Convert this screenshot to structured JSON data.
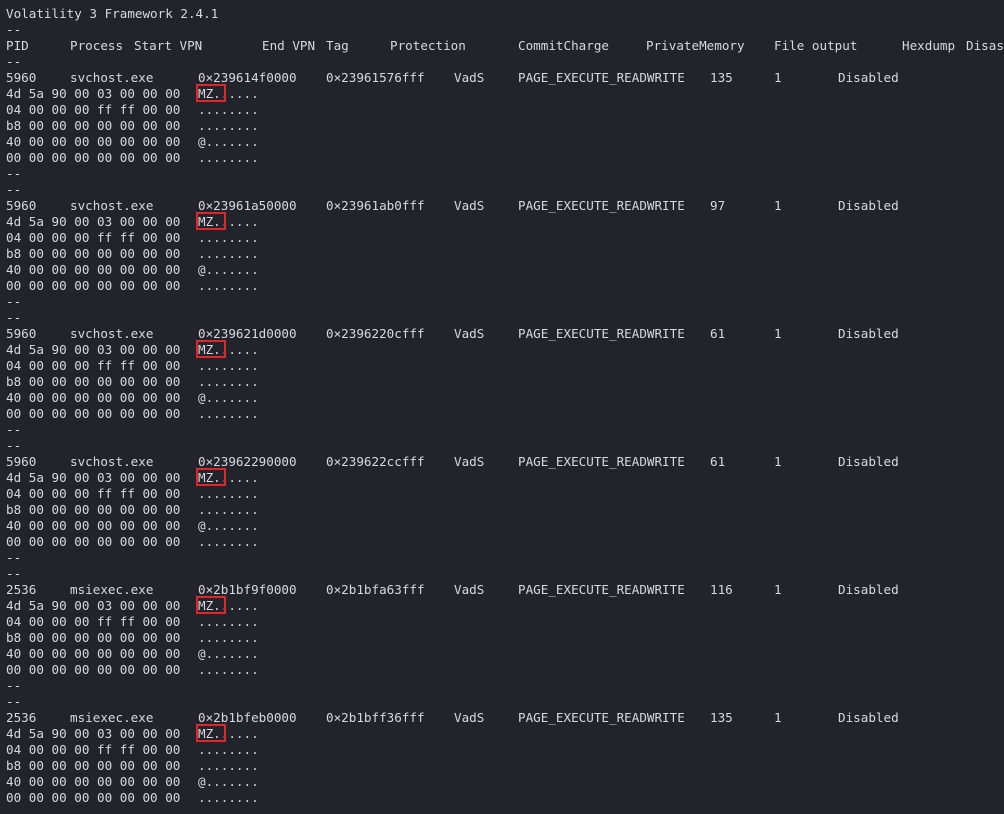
{
  "title": "Volatility 3 Framework 2.4.1",
  "separator": "--",
  "headers": [
    "PID",
    "Process",
    "Start VPN",
    "End VPN",
    "Tag",
    "Protection",
    "CommitCharge",
    "PrivateMemory",
    "File output",
    "Hexdump",
    "Disas"
  ],
  "entries": [
    {
      "pid": "5960",
      "process": "svchost.exe",
      "start_vpn": "0×239614f0000",
      "end_vpn": "0×23961576fff",
      "tag": "VadS",
      "protection": "PAGE_EXECUTE_READWRITE",
      "commit_charge": "135",
      "private_memory": "1",
      "file_output": "Disabled",
      "hexdump": [
        {
          "hex": "4d 5a 90 00 03 00 00 00",
          "ascii": "MZ......"
        },
        {
          "hex": "04 00 00 00 ff ff 00 00",
          "ascii": "........"
        },
        {
          "hex": "b8 00 00 00 00 00 00 00",
          "ascii": "........"
        },
        {
          "hex": "40 00 00 00 00 00 00 00",
          "ascii": "@......."
        },
        {
          "hex": "00 00 00 00 00 00 00 00",
          "ascii": "........"
        }
      ]
    },
    {
      "pid": "5960",
      "process": "svchost.exe",
      "start_vpn": "0×23961a50000",
      "end_vpn": "0×23961ab0fff",
      "tag": "VadS",
      "protection": "PAGE_EXECUTE_READWRITE",
      "commit_charge": "97",
      "private_memory": "1",
      "file_output": "Disabled",
      "hexdump": [
        {
          "hex": "4d 5a 90 00 03 00 00 00",
          "ascii": "MZ......"
        },
        {
          "hex": "04 00 00 00 ff ff 00 00",
          "ascii": "........"
        },
        {
          "hex": "b8 00 00 00 00 00 00 00",
          "ascii": "........"
        },
        {
          "hex": "40 00 00 00 00 00 00 00",
          "ascii": "@......."
        },
        {
          "hex": "00 00 00 00 00 00 00 00",
          "ascii": "........"
        }
      ]
    },
    {
      "pid": "5960",
      "process": "svchost.exe",
      "start_vpn": "0×239621d0000",
      "end_vpn": "0×2396220cfff",
      "tag": "VadS",
      "protection": "PAGE_EXECUTE_READWRITE",
      "commit_charge": "61",
      "private_memory": "1",
      "file_output": "Disabled",
      "hexdump": [
        {
          "hex": "4d 5a 90 00 03 00 00 00",
          "ascii": "MZ......"
        },
        {
          "hex": "04 00 00 00 ff ff 00 00",
          "ascii": "........"
        },
        {
          "hex": "b8 00 00 00 00 00 00 00",
          "ascii": "........"
        },
        {
          "hex": "40 00 00 00 00 00 00 00",
          "ascii": "@......."
        },
        {
          "hex": "00 00 00 00 00 00 00 00",
          "ascii": "........"
        }
      ]
    },
    {
      "pid": "5960",
      "process": "svchost.exe",
      "start_vpn": "0×23962290000",
      "end_vpn": "0×239622ccfff",
      "tag": "VadS",
      "protection": "PAGE_EXECUTE_READWRITE",
      "commit_charge": "61",
      "private_memory": "1",
      "file_output": "Disabled",
      "hexdump": [
        {
          "hex": "4d 5a 90 00 03 00 00 00",
          "ascii": "MZ......"
        },
        {
          "hex": "04 00 00 00 ff ff 00 00",
          "ascii": "........"
        },
        {
          "hex": "b8 00 00 00 00 00 00 00",
          "ascii": "........"
        },
        {
          "hex": "40 00 00 00 00 00 00 00",
          "ascii": "@......."
        },
        {
          "hex": "00 00 00 00 00 00 00 00",
          "ascii": "........"
        }
      ]
    },
    {
      "pid": "2536",
      "process": "msiexec.exe",
      "start_vpn": "0×2b1bf9f0000",
      "end_vpn": "0×2b1bfa63fff",
      "tag": "VadS",
      "protection": "PAGE_EXECUTE_READWRITE",
      "commit_charge": "116",
      "private_memory": "1",
      "file_output": "Disabled",
      "hexdump": [
        {
          "hex": "4d 5a 90 00 03 00 00 00",
          "ascii": "MZ......"
        },
        {
          "hex": "04 00 00 00 ff ff 00 00",
          "ascii": "........"
        },
        {
          "hex": "b8 00 00 00 00 00 00 00",
          "ascii": "........"
        },
        {
          "hex": "40 00 00 00 00 00 00 00",
          "ascii": "@......."
        },
        {
          "hex": "00 00 00 00 00 00 00 00",
          "ascii": "........"
        }
      ]
    },
    {
      "pid": "2536",
      "process": "msiexec.exe",
      "start_vpn": "0×2b1bfeb0000",
      "end_vpn": "0×2b1bff36fff",
      "tag": "VadS",
      "protection": "PAGE_EXECUTE_READWRITE",
      "commit_charge": "135",
      "private_memory": "1",
      "file_output": "Disabled",
      "hexdump": [
        {
          "hex": "4d 5a 90 00 03 00 00 00",
          "ascii": "MZ......"
        },
        {
          "hex": "04 00 00 00 ff ff 00 00",
          "ascii": "........"
        },
        {
          "hex": "b8 00 00 00 00 00 00 00",
          "ascii": "........"
        },
        {
          "hex": "40 00 00 00 00 00 00 00",
          "ascii": "@......."
        },
        {
          "hex": "00 00 00 00 00 00 00 00",
          "ascii": "........"
        }
      ]
    }
  ],
  "highlight_color": "#e0252b"
}
